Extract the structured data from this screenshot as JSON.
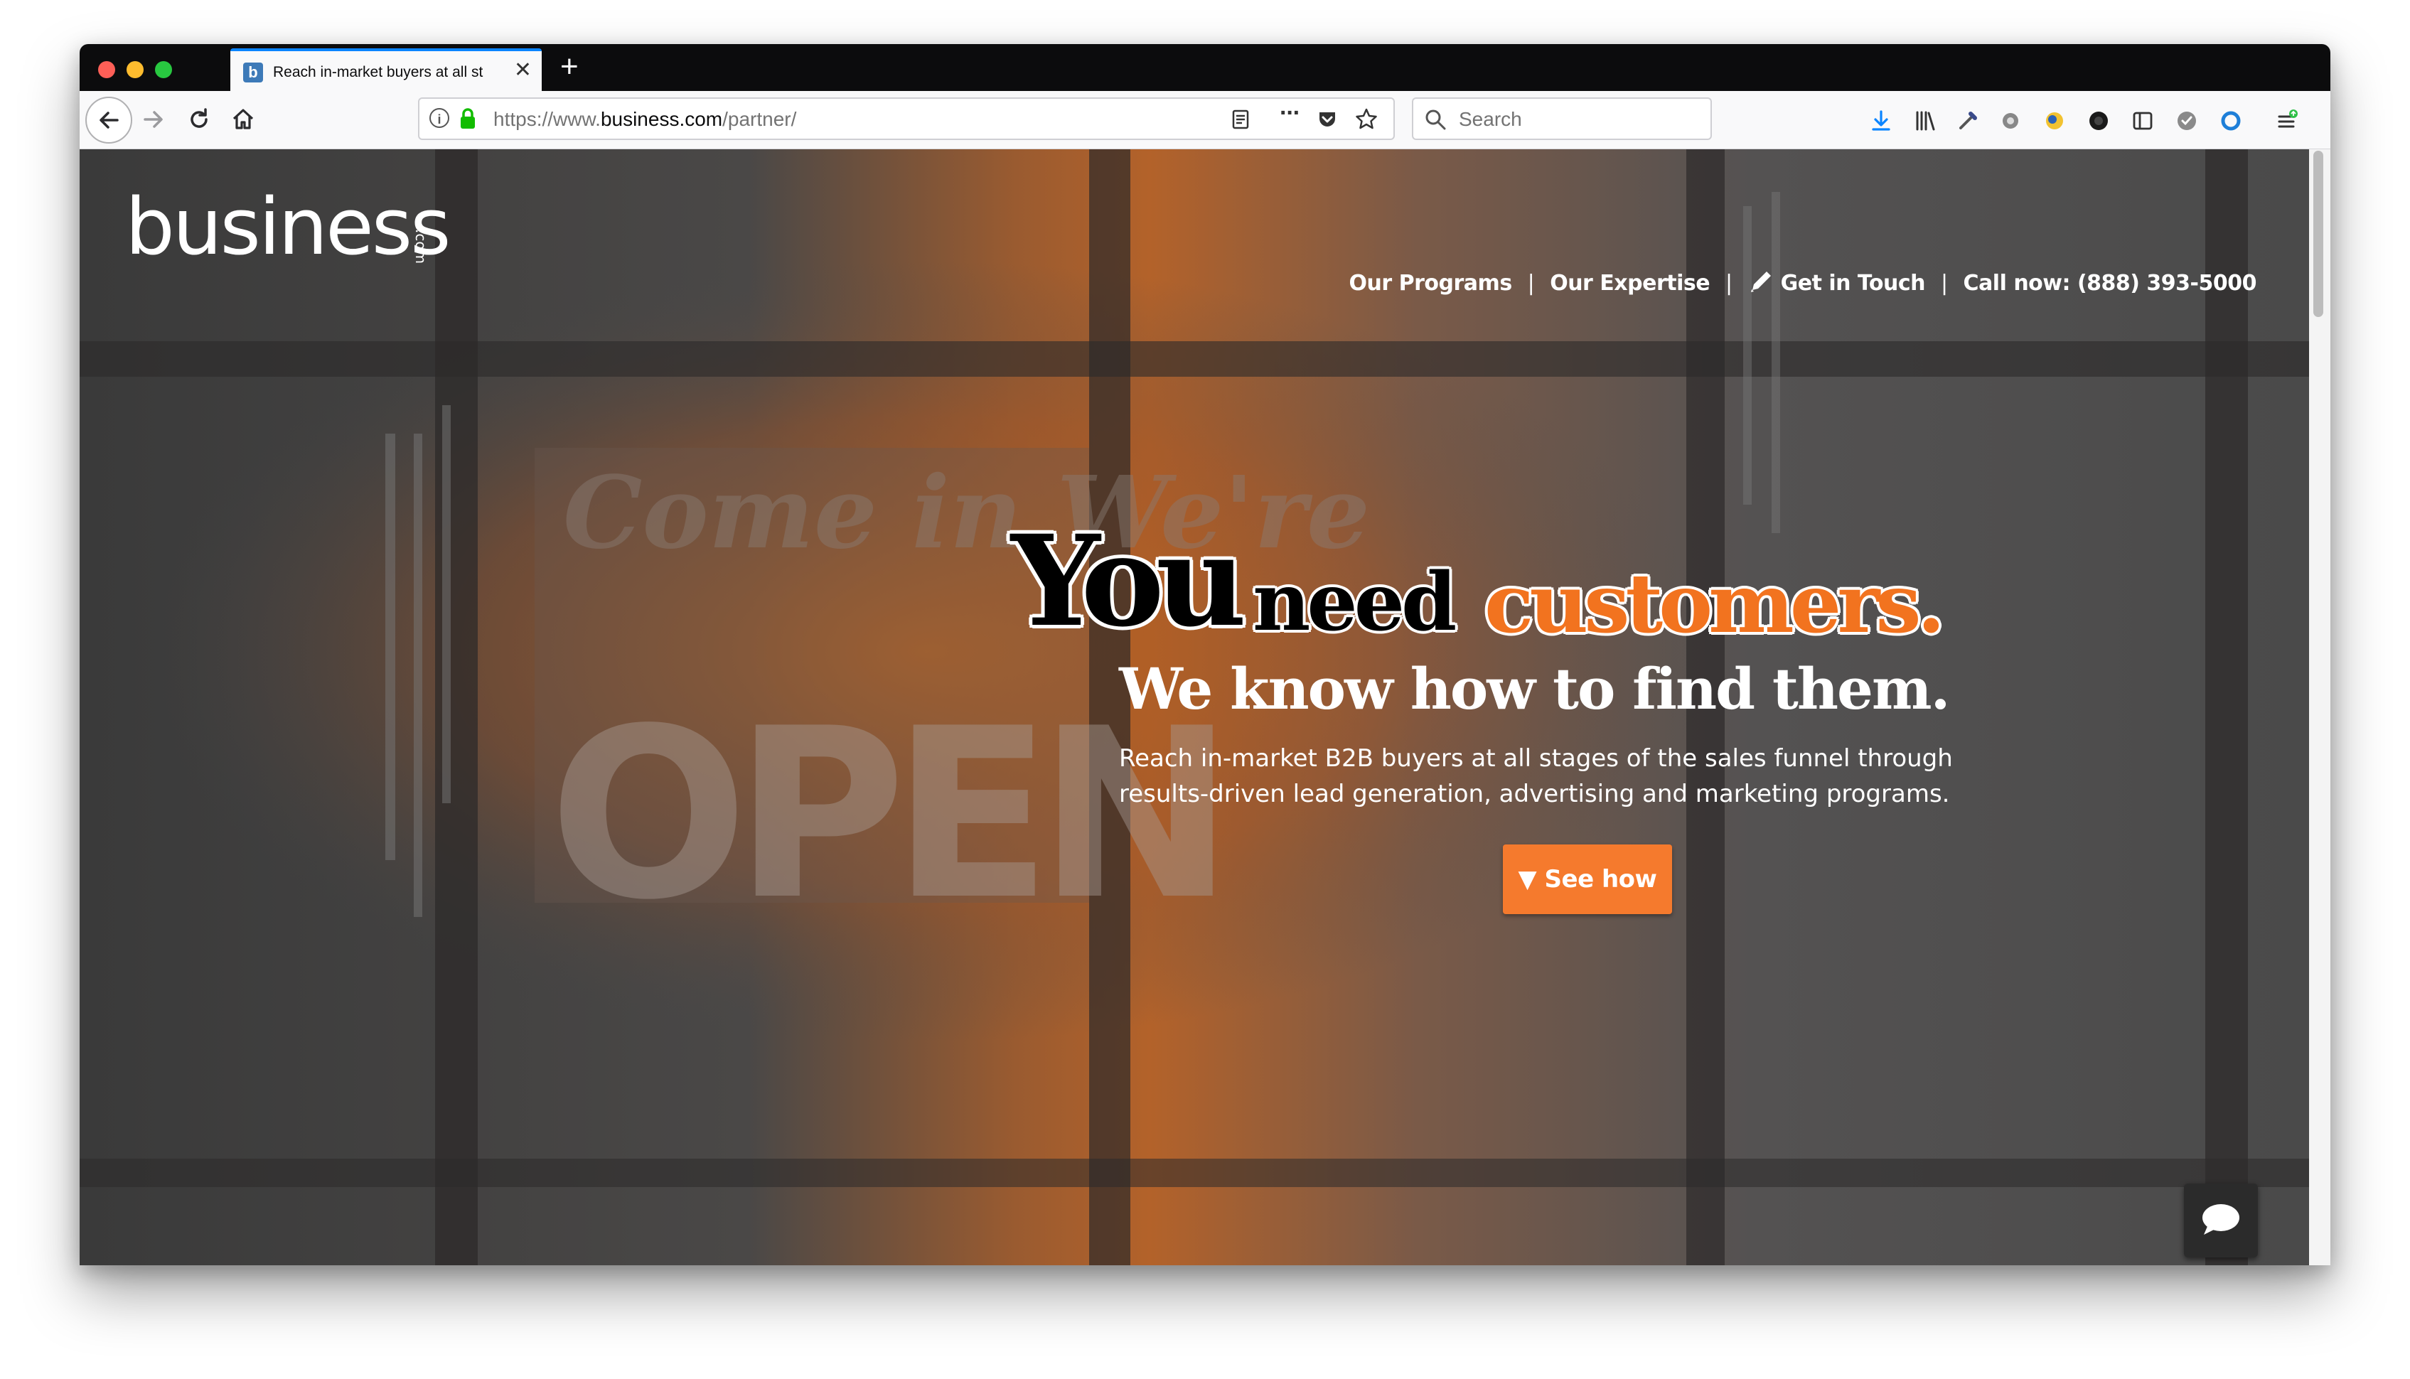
{
  "browser": {
    "tab": {
      "title": "Reach in-market buyers at all st",
      "favicon": "b",
      "close": "✕"
    },
    "new_tab": "+",
    "url": {
      "prefix": "https://www.",
      "domain": "business.com",
      "path": "/partner/"
    },
    "search": {
      "placeholder": "Search"
    },
    "nav_icons": [
      "back-icon",
      "forward-icon",
      "reload-icon",
      "home-icon"
    ],
    "url_icons": [
      "info-icon",
      "lock-icon",
      "reader-view-icon",
      "page-actions-icon",
      "pocket-icon",
      "bookmark-star-icon"
    ],
    "toolbar_icons": [
      "downloads-icon",
      "library-icon",
      "eyedropper-icon",
      "extension-gear-icon",
      "extension-icon",
      "extension-dark-icon",
      "sidebar-icon",
      "extension-check-icon",
      "extension-ring-icon",
      "menu-icon"
    ]
  },
  "site": {
    "logo": {
      "text": "business",
      "suffix": ".com"
    },
    "nav": {
      "programs": "Our Programs",
      "expertise": "Our Expertise",
      "contact": "Get in Touch",
      "phone": "Call now: (888) 393-5000",
      "separator": "|"
    },
    "hero": {
      "you": "You",
      "need": "need",
      "customers": "customers.",
      "subtitle": "We know how to find them.",
      "description": "Reach in-market B2B buyers at all stages of the sales funnel through results-driven lead generation, advertising and marketing programs.",
      "cta": "▼ See how"
    },
    "chat": {
      "icon": "chat-bubble-icon"
    }
  },
  "colors": {
    "accent": "#f2731f",
    "cta_bg": "#f57a2d",
    "chrome_dark": "#0c0c0d",
    "tab_highlight": "#0a84ff"
  }
}
